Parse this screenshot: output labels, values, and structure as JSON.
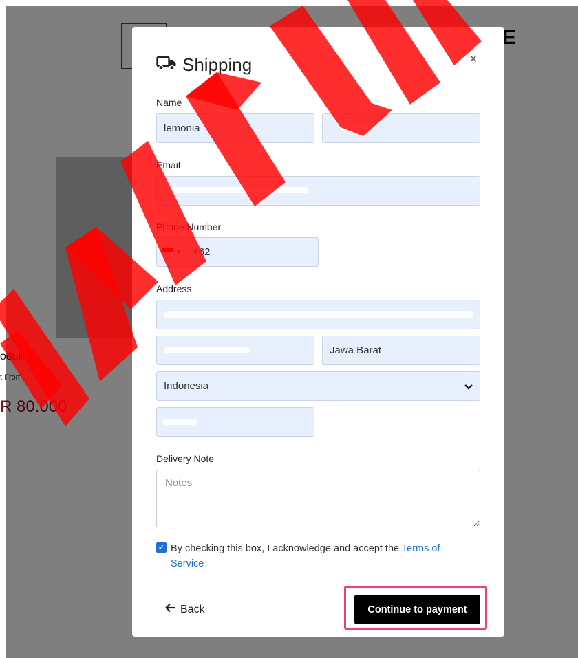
{
  "background": {
    "brand_letter": "E",
    "product_name": "oduk 2",
    "product_from": "t From",
    "product_price": "R 80.000"
  },
  "modal": {
    "title": "Shipping",
    "title_icon": "truck-icon",
    "close_label": "×",
    "name": {
      "label": "Name",
      "first_value": "lemonia",
      "last_value": ""
    },
    "email": {
      "label": "Email",
      "value": ""
    },
    "phone": {
      "label": "Phone Number",
      "country_flag": "indonesia-flag-icon",
      "value": "+62"
    },
    "address": {
      "label": "Address",
      "street_value": "",
      "city_value": "",
      "province_value": "Jawa Barat",
      "country_value": "Indonesia",
      "postal_value": ""
    },
    "delivery_note": {
      "label": "Delivery Note",
      "placeholder": "Notes"
    },
    "consent": {
      "checked": true,
      "text": "By checking this box, I acknowledge and accept the ",
      "link_text": "Terms of Service"
    },
    "back_label": "Back",
    "continue_label": "Continue to payment"
  },
  "colors": {
    "field_bg": "#e8f0fe",
    "link": "#1f6fd1",
    "primary_button": "#000000",
    "highlight": "#ef3f6f",
    "price": "#8a0f1c",
    "watermark": "#ff0000"
  }
}
